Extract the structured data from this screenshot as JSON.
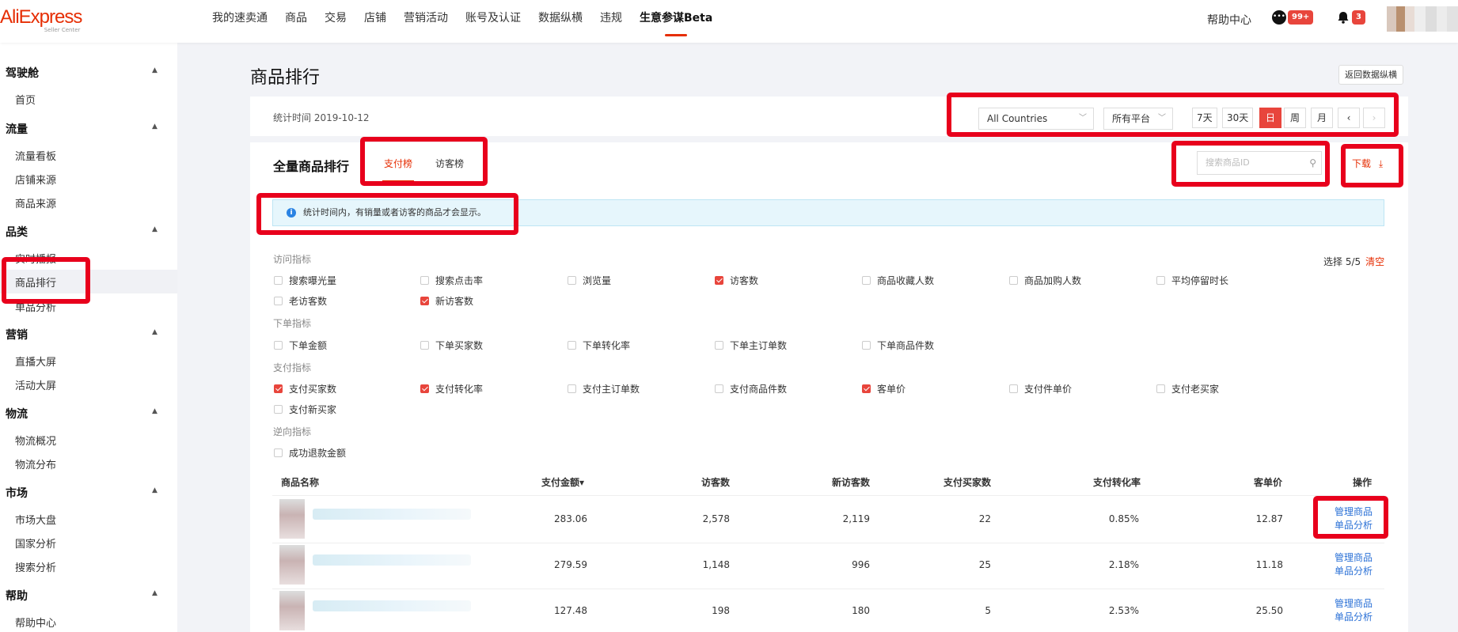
{
  "header": {
    "logo": "AliExpress",
    "logo_sub": "Seller Center",
    "nav": [
      "我的速卖通",
      "商品",
      "交易",
      "店铺",
      "营销活动",
      "账号及认证",
      "数据纵横",
      "违规",
      "生意参谋Beta"
    ],
    "help": "帮助中心",
    "messages_badge": "99+",
    "notifications_badge": "3"
  },
  "sidebar": {
    "groups": [
      {
        "title": "驾驶舱",
        "items": [
          "首页"
        ]
      },
      {
        "title": "流量",
        "items": [
          "流量看板",
          "店铺来源",
          "商品来源"
        ]
      },
      {
        "title": "品类",
        "items": [
          "实时播报",
          "商品排行",
          "单品分析"
        ]
      },
      {
        "title": "营销",
        "items": [
          "直播大屏",
          "活动大屏"
        ]
      },
      {
        "title": "物流",
        "items": [
          "物流概况",
          "物流分布"
        ]
      },
      {
        "title": "市场",
        "items": [
          "市场大盘",
          "国家分析",
          "搜索分析"
        ]
      },
      {
        "title": "帮助",
        "items": [
          "帮助中心"
        ]
      }
    ]
  },
  "page": {
    "title": "商品排行",
    "back_button": "返回数据纵横",
    "stat_time": "统计时间 2019-10-12",
    "country_select": "All Countries",
    "platform_select": "所有平台",
    "period_buttons": [
      "7天",
      "30天",
      "日",
      "周",
      "月"
    ],
    "period_active": "日",
    "section_title": "全量商品排行",
    "tabs": [
      "支付榜",
      "访客榜"
    ],
    "tab_active": "支付榜",
    "search_placeholder": "搜索商品ID",
    "download": "下载",
    "info_text": "统计时间内，有销量或者访客的商品才会显示。",
    "selection_count": "选择 5/5",
    "clear": "清空"
  },
  "metrics": [
    {
      "group": "访问指标",
      "items": [
        {
          "label": "搜索曝光量",
          "checked": false
        },
        {
          "label": "搜索点击率",
          "checked": false
        },
        {
          "label": "浏览量",
          "checked": false
        },
        {
          "label": "访客数",
          "checked": true
        },
        {
          "label": "商品收藏人数",
          "checked": false
        },
        {
          "label": "商品加购人数",
          "checked": false
        },
        {
          "label": "平均停留时长",
          "checked": false
        },
        {
          "label": "老访客数",
          "checked": false
        },
        {
          "label": "新访客数",
          "checked": true
        }
      ]
    },
    {
      "group": "下单指标",
      "items": [
        {
          "label": "下单金额",
          "checked": false
        },
        {
          "label": "下单买家数",
          "checked": false
        },
        {
          "label": "下单转化率",
          "checked": false
        },
        {
          "label": "下单主订单数",
          "checked": false
        },
        {
          "label": "下单商品件数",
          "checked": false
        }
      ]
    },
    {
      "group": "支付指标",
      "items": [
        {
          "label": "支付买家数",
          "checked": true
        },
        {
          "label": "支付转化率",
          "checked": true
        },
        {
          "label": "支付主订单数",
          "checked": false
        },
        {
          "label": "支付商品件数",
          "checked": false
        },
        {
          "label": "客单价",
          "checked": true
        },
        {
          "label": "支付件单价",
          "checked": false
        },
        {
          "label": "支付老买家",
          "checked": false
        },
        {
          "label": "支付新买家",
          "checked": false
        }
      ]
    },
    {
      "group": "逆向指标",
      "items": [
        {
          "label": "成功退款金额",
          "checked": false
        }
      ]
    }
  ],
  "table": {
    "headers": [
      "商品名称",
      "支付金额",
      "访客数",
      "新访客数",
      "支付买家数",
      "支付转化率",
      "客单价",
      "操作"
    ],
    "sort_indicator": "▾",
    "rows": [
      [
        "283.06",
        "2,578",
        "2,119",
        "22",
        "0.85%",
        "12.87"
      ],
      [
        "279.59",
        "1,148",
        "996",
        "25",
        "2.18%",
        "11.18"
      ],
      [
        "127.48",
        "198",
        "180",
        "5",
        "2.53%",
        "25.50"
      ]
    ],
    "actions": [
      "管理商品",
      "单品分析"
    ]
  }
}
